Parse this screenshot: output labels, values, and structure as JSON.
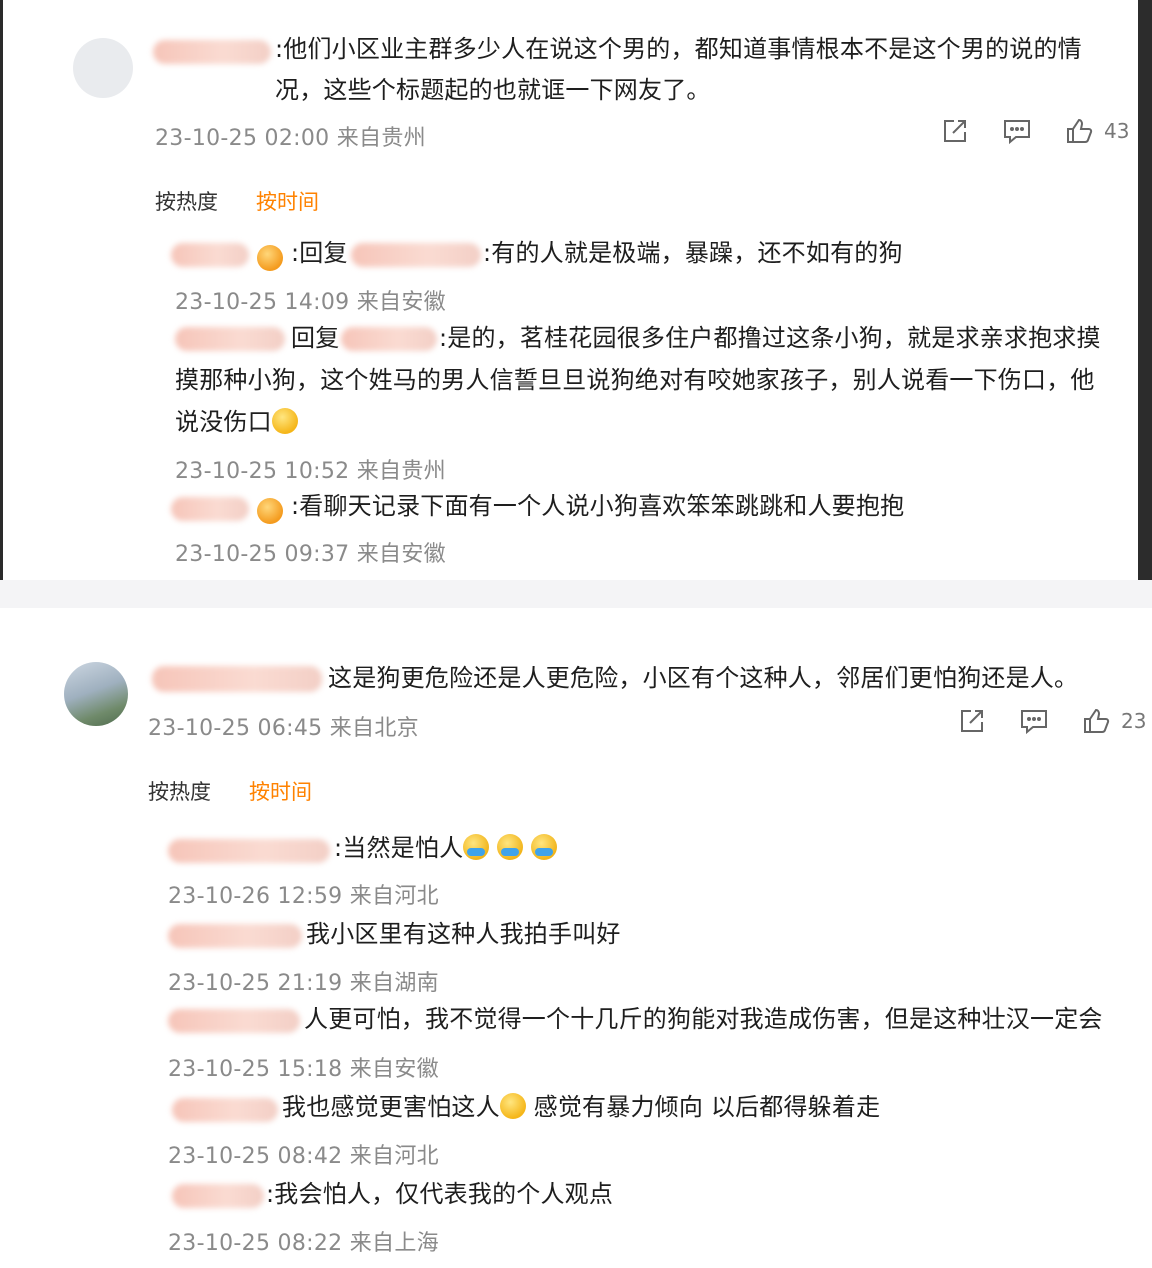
{
  "thread1": {
    "comment_text": ":他们小区业主群多少人在说这个男的，都知道事情根本不是这个男的说的情况，这些个标题起的也就诓一下网友了。",
    "meta": "23-10-25 02:00 来自贵州",
    "like_count": "43",
    "sort": {
      "hot": "按热度",
      "time": "按时间"
    },
    "replies": [
      {
        "text": ":回复",
        "text2": ":有的人就是极端，暴躁，还不如有的狗",
        "meta": "23-10-25 14:09 来自安徽"
      },
      {
        "text": "回复",
        "text2": ":是的，茗桂花园很多住户都撸过这条小狗，就是求亲求抱求摸",
        "text3": "摸那种小狗，这个姓马的男人信誓旦旦说狗绝对有咬她家孩子，别人说看一下伤口，他",
        "text4": "说没伤口",
        "meta": "23-10-25 10:52 来自贵州"
      },
      {
        "text": ":看聊天记录下面有一个人说小狗喜欢笨笨跳跳和人要抱抱",
        "meta": "23-10-25 09:37 来自安徽"
      }
    ]
  },
  "thread2": {
    "comment_text": "这是狗更危险还是人更危险，小区有个这种人，邻居们更怕狗还是人。",
    "meta": "23-10-25 06:45 来自北京",
    "like_count": "23",
    "sort": {
      "hot": "按热度",
      "time": "按时间"
    },
    "replies": [
      {
        "text": ":当然是怕人",
        "meta": "23-10-26 12:59 来自河北"
      },
      {
        "text": "我小区里有这种人我拍手叫好",
        "meta": "23-10-25 21:19 来自湖南"
      },
      {
        "text": "人更可怕，我不觉得一个十几斤的狗能对我造成伤害，但是这种壮汉一定会",
        "meta": "23-10-25 15:18 来自安徽"
      },
      {
        "text": "我也感觉更害怕这人",
        "text2": " 感觉有暴力倾向 以后都得躲着走",
        "meta": "23-10-25 08:42 来自河北"
      },
      {
        "text": ":我会怕人，仅代表我的个人观点",
        "meta": "23-10-25 08:22 来自上海"
      }
    ]
  },
  "icons": [
    "share-icon",
    "comment-icon",
    "like-icon"
  ],
  "colors": {
    "accent": "#ff8200",
    "meta": "#8a8a8a",
    "text": "#1e1e1e"
  }
}
